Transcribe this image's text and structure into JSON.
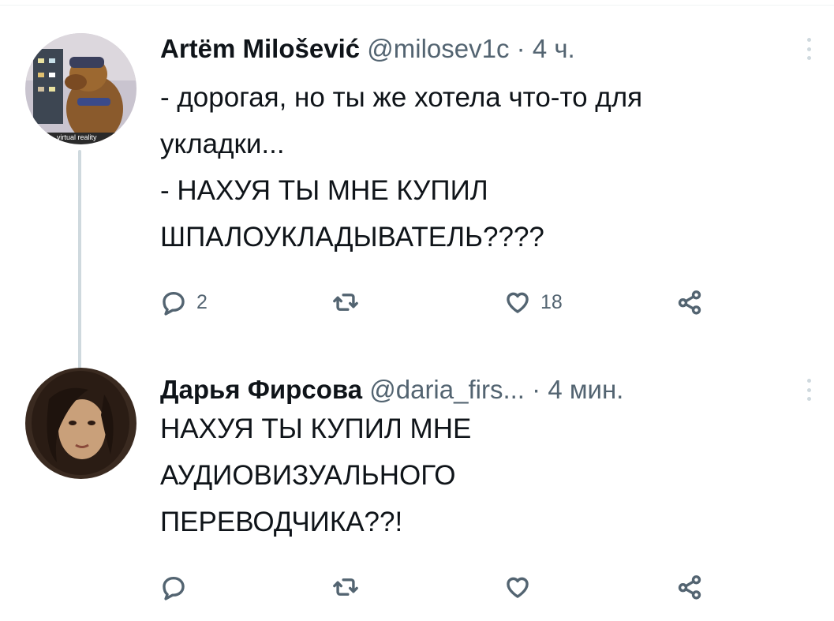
{
  "tweets": [
    {
      "author_name": "Artёm Milošević",
      "handle": "@milosev1c",
      "separator": "·",
      "time": "4 ч.",
      "avatar_caption": "virtual reality",
      "text_lines": [
        "- дорогая, но ты же хотела что-то для",
        "укладки...",
        "- НАХУЯ ТЫ МНЕ КУПИЛ",
        "ШПАЛОУКЛАДЫВАТЕЛЬ????"
      ],
      "reply_count": "2",
      "retweet_count": "",
      "like_count": "18"
    },
    {
      "author_name": "Дарья Фирсова",
      "handle": "@daria_firs...",
      "separator": "·",
      "time": "4 мин.",
      "text_lines": [
        "НАХУЯ ТЫ КУПИЛ МНЕ",
        "АУДИОВИЗУАЛЬНОГО",
        "ПЕРЕВОДЧИКА??!"
      ],
      "reply_count": "",
      "retweet_count": "",
      "like_count": ""
    }
  ],
  "icons": {
    "reply": "speech-bubble-icon",
    "retweet": "retweet-arrows-icon",
    "like": "heart-icon",
    "share": "share-nodes-icon",
    "more": "vertical-dots-icon"
  },
  "colors": {
    "text": "#0f1419",
    "secondary": "#536471",
    "thread_line": "#cfd9de",
    "background": "#ffffff"
  }
}
